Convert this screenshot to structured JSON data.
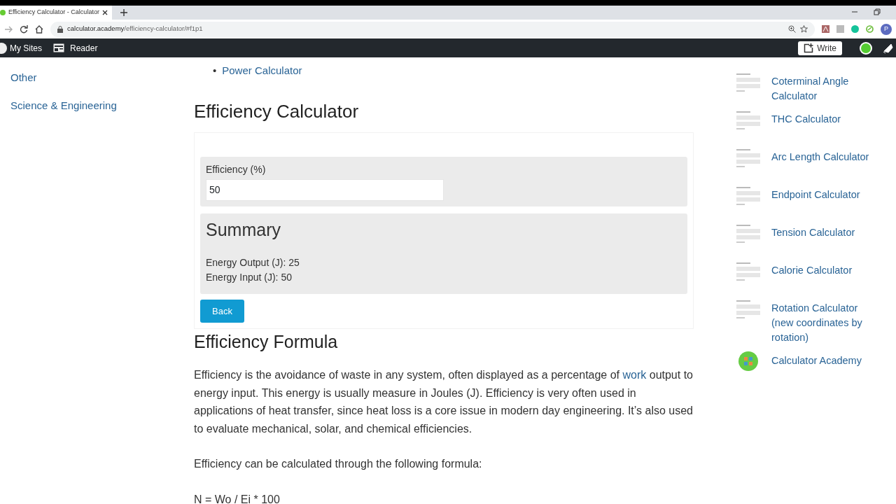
{
  "browser": {
    "tab_title": "Efficiency Calculator - Calculator",
    "url_host": "calculator.academy",
    "url_path": "/efficiency-calculator/#f1p1",
    "profile_initial": "P"
  },
  "admin_bar": {
    "items": [
      "My Sites",
      "Reader"
    ],
    "write_button": "Write"
  },
  "sidebar": {
    "items": [
      "Other",
      "Science & Engineering"
    ]
  },
  "related_list": [
    {
      "bullet": "•",
      "label": "Power Calculator"
    }
  ],
  "calculator": {
    "title": "Efficiency Calculator",
    "field_label": "Efficiency (%)",
    "field_value": "50",
    "summary_title": "Summary",
    "summary_lines": [
      "Energy Output (J): 25",
      "Energy Input (J): 50"
    ],
    "back_button": "Back"
  },
  "formula": {
    "heading": "Efficiency Formula",
    "paragraph_before": "Efficiency is the avoidance of waste in any system, often displayed as a percentage of",
    "paragraph_link": "work",
    "paragraph_after": "output to energy input. This energy is usually measure in Joules (J). Efficiency is very often used in applications of heat transfer, since heat loss is a core issue in modern day engineering. It’s also used to evaluate mechanical, solar, and chemical efficiencies.",
    "intro": "Efficiency can be calculated through the following formula:",
    "equation": "N = Wo / Ei * 100"
  },
  "right_list": [
    {
      "kind": "thumbnail",
      "label": "Coterminal Angle Calculator"
    },
    {
      "kind": "thumbnail",
      "label": "THC Calculator"
    },
    {
      "kind": "thumbnail",
      "label": "Arc Length Calculator"
    },
    {
      "kind": "thumbnail",
      "label": "Endpoint Calculator"
    },
    {
      "kind": "thumbnail",
      "label": "Tension Calculator"
    },
    {
      "kind": "thumbnail",
      "label": "Calorie Calculator"
    },
    {
      "kind": "thumbnail",
      "label": "Rotation Calculator (new coordinates by rotation)"
    },
    {
      "kind": "logo",
      "label": "Calculator Academy"
    }
  ]
}
